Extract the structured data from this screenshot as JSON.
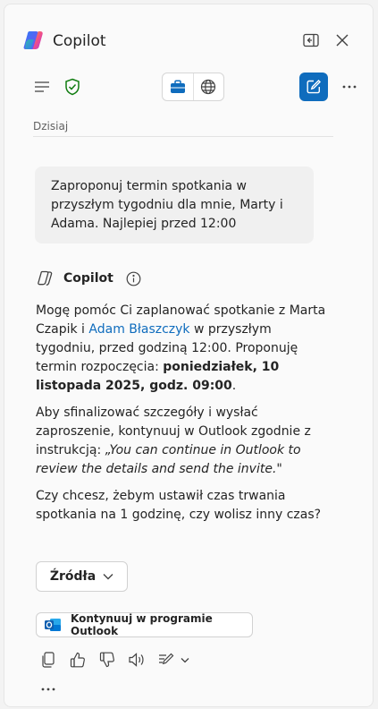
{
  "header": {
    "title": "Copilot",
    "icons": {
      "logo": "copilot-logo",
      "sidepane": "sidepane-icon",
      "close": "close-icon"
    }
  },
  "toolbar": {
    "icons": [
      "menu-icon",
      "shield-check-icon",
      "briefcase-icon",
      "globe-icon",
      "new-chat-icon",
      "more-icon"
    ],
    "accent_color": "#0f6cbd",
    "shield_color": "#107c10"
  },
  "conversation": {
    "date_label": "Dzisiaj",
    "user_message": "Zaproponuj termin spotkania w przyszłym tygodniu dla mnie, Marty i Adama. Najlepiej przed 12:00",
    "assistant": {
      "name": "Copilot",
      "p1_a": "Mogę pomóc Ci zaplanować spotkanie z Marta Czapik i ",
      "p1_link": "Adam Błaszczyk",
      "p1_b": " w przyszłym tygodniu, przed godziną 12:00. Proponuję termin rozpoczęcia: ",
      "p1_bold": "poniedziałek, 10 listopada 2025, godz. 09:00",
      "p1_end": ".",
      "p2_a": "Aby sfinalizować szczegóły i wysłać zaproszenie, kontynuuj w Outlook zgodnie z instrukcją: ",
      "p2_quote": "„You can continue in Outlook to review the details and send the invite.\"",
      "p3": "Czy chcesz, żebym ustawił czas trwania spotkania na 1 godzinę, czy wolisz inny czas?"
    },
    "sources_label": "Źródła",
    "outlook_label": "Kontynuuj w programie Outlook",
    "action_icons": [
      "copy-icon",
      "thumbs-up-icon",
      "thumbs-down-icon",
      "speaker-icon",
      "edit-icon",
      "chevron-down-icon",
      "more-icon"
    ]
  }
}
